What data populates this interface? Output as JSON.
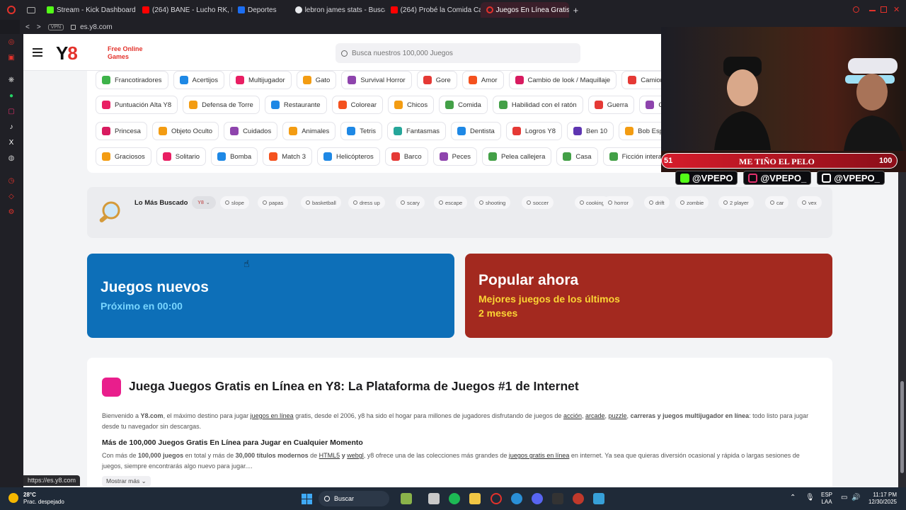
{
  "browser": {
    "tabs": [
      {
        "label": "Stream - Kick Dashboard",
        "color": "#53fc18"
      },
      {
        "label": "(264) BANE - Lucho RK, L",
        "color": "#ff0000"
      },
      {
        "label": "Deportes",
        "color": "#1c6ef2"
      },
      {
        "label": "lebron james stats - Busca",
        "color": "#e8eaed"
      },
      {
        "label": "(264) Probé la Comida Ca",
        "color": "#ff0000"
      },
      {
        "label": "Juegos En Línea Gratis",
        "color": "#e3322b"
      }
    ],
    "new_tab": "+",
    "vpn": "VPN",
    "url": "es.y8.com",
    "status_url": "https://es.y8.com"
  },
  "site": {
    "logo_main": "Y",
    "logo_accent": "8",
    "tagline_1": "Free Online",
    "tagline_2": "Games",
    "search_placeholder": "Busca nuestros 100,000 Juegos"
  },
  "categories": {
    "row1": [
      {
        "label": "Francotiradores",
        "color": "#3eb34a"
      },
      {
        "label": "Acertijos",
        "color": "#1e88e5"
      },
      {
        "label": "Multijugador",
        "color": "#e91e63"
      },
      {
        "label": "Gato",
        "color": "#f39c12"
      },
      {
        "label": "Survival Horror",
        "color": "#8e44ad"
      },
      {
        "label": "Gore",
        "color": "#e53935"
      },
      {
        "label": "Amor",
        "color": "#f4511e"
      },
      {
        "label": "Cambio de look / Maquillaje",
        "color": "#d81b60"
      },
      {
        "label": "Camiones",
        "color": "#e53935"
      }
    ],
    "row2": [
      {
        "label": "Puntuación Alta Y8",
        "color": "#e91e63"
      },
      {
        "label": "Defensa de Torre",
        "color": "#f39c12"
      },
      {
        "label": "Restaurante",
        "color": "#1e88e5"
      },
      {
        "label": "Colorear",
        "color": "#f4511e"
      },
      {
        "label": "Chicos",
        "color": "#f39c12"
      },
      {
        "label": "Comida",
        "color": "#43a047"
      },
      {
        "label": "Habilidad con el ratón",
        "color": "#43a047"
      },
      {
        "label": "Guerra",
        "color": "#e53935"
      },
      {
        "label": "Clic",
        "color": "#8e44ad"
      }
    ],
    "row3": [
      {
        "label": "Princesa",
        "color": "#d81b60"
      },
      {
        "label": "Objeto Oculto",
        "color": "#f39c12"
      },
      {
        "label": "Cuidados",
        "color": "#8e44ad"
      },
      {
        "label": "Animales",
        "color": "#f39c12"
      },
      {
        "label": "Tetris",
        "color": "#1e88e5"
      },
      {
        "label": "Fantasmas",
        "color": "#26a69a"
      },
      {
        "label": "Dentista",
        "color": "#1e88e5"
      },
      {
        "label": "Logros Y8",
        "color": "#e53935"
      },
      {
        "label": "Ben 10",
        "color": "#5e35b1"
      },
      {
        "label": "Bob Esponja",
        "color": "#f39c12"
      }
    ],
    "row4": [
      {
        "label": "Graciosos",
        "color": "#f39c12"
      },
      {
        "label": "Solitario",
        "color": "#e91e63"
      },
      {
        "label": "Bomba",
        "color": "#1e88e5"
      },
      {
        "label": "Match 3",
        "color": "#f4511e"
      },
      {
        "label": "Helicópteros",
        "color": "#1e88e5"
      },
      {
        "label": "Barco",
        "color": "#e53935"
      },
      {
        "label": "Peces",
        "color": "#8e44ad"
      },
      {
        "label": "Pelea callejera",
        "color": "#43a047"
      },
      {
        "label": "Casa",
        "color": "#43a047"
      },
      {
        "label": "Ficción interactiv",
        "color": "#43a047"
      }
    ]
  },
  "trending": {
    "title": "Lo Más Buscado",
    "lang": "Y8",
    "keywords": [
      "slope",
      "papas",
      "basketball",
      "dress up",
      "scary",
      "escape",
      "shooting",
      "soccer",
      "cooking",
      "horror",
      "drift",
      "zombie",
      "2 player",
      "car",
      "vex"
    ]
  },
  "banners": {
    "new_title": "Juegos nuevos",
    "new_sub": "Próximo en 00:00",
    "popular_title": "Popular ahora",
    "popular_sub_1": "Mejores juegos de los últimos",
    "popular_sub_2": "2 meses"
  },
  "article": {
    "title": "Juega Juegos Gratis en Línea en Y8: La Plataforma de Juegos #1 de Internet",
    "p1_a": "Bienvenido a ",
    "p1_b": "Y8.com",
    "p1_c": ", el máximo destino para jugar ",
    "p1_d": "juegos en línea",
    "p1_e": " gratis, desde el 2006, y8 ha sido el hogar para millones de jugadores disfrutando de juegos de ",
    "p1_f": "acción",
    "p1_g": "arcade",
    "p1_h": "puzzle",
    "p1_i": "carreras y juegos multijugador en línea",
    "p1_j": ": todo listo para jugar desde tu navegador sin descargas.",
    "h2": "Más de 100,000 Juegos Gratis En Línea para Jugar en Cualquier Momento",
    "p2_a": "Con más de ",
    "p2_b": "100,000 juegos",
    "p2_c": " en total y más de ",
    "p2_d": "30,000 títulos modernos",
    "p2_e": " de ",
    "p2_f": "HTML5",
    "p2_g": " y ",
    "p2_h": "webgl",
    "p2_i": ", y8 ofrece una de las colecciones más grandes de ",
    "p2_j": "juegos gratis en línea",
    "p2_k": " en internet. Ya sea que quieras diversión ocasional y rápida o largas sesiones de juegos, siempre encontrarás algo nuevo para jugar....",
    "more": "Mostrar más"
  },
  "overlay": {
    "left_num": "51",
    "title": "ME TIÑO EL PELO",
    "right_num": "100",
    "socials": [
      {
        "handle": "@VPEPO",
        "color": "#53fc18"
      },
      {
        "handle": "@VPEPO_",
        "color": "#e1306c"
      },
      {
        "handle": "@VPEPO_",
        "color": "#ffffff"
      }
    ]
  },
  "taskbar": {
    "weather_temp": "28°C",
    "weather_desc": "Prac. despejado",
    "search": "Buscar",
    "lang": "ESP",
    "lang2": "LAA",
    "time": "11:17 PM",
    "date": "12/30/2025"
  }
}
